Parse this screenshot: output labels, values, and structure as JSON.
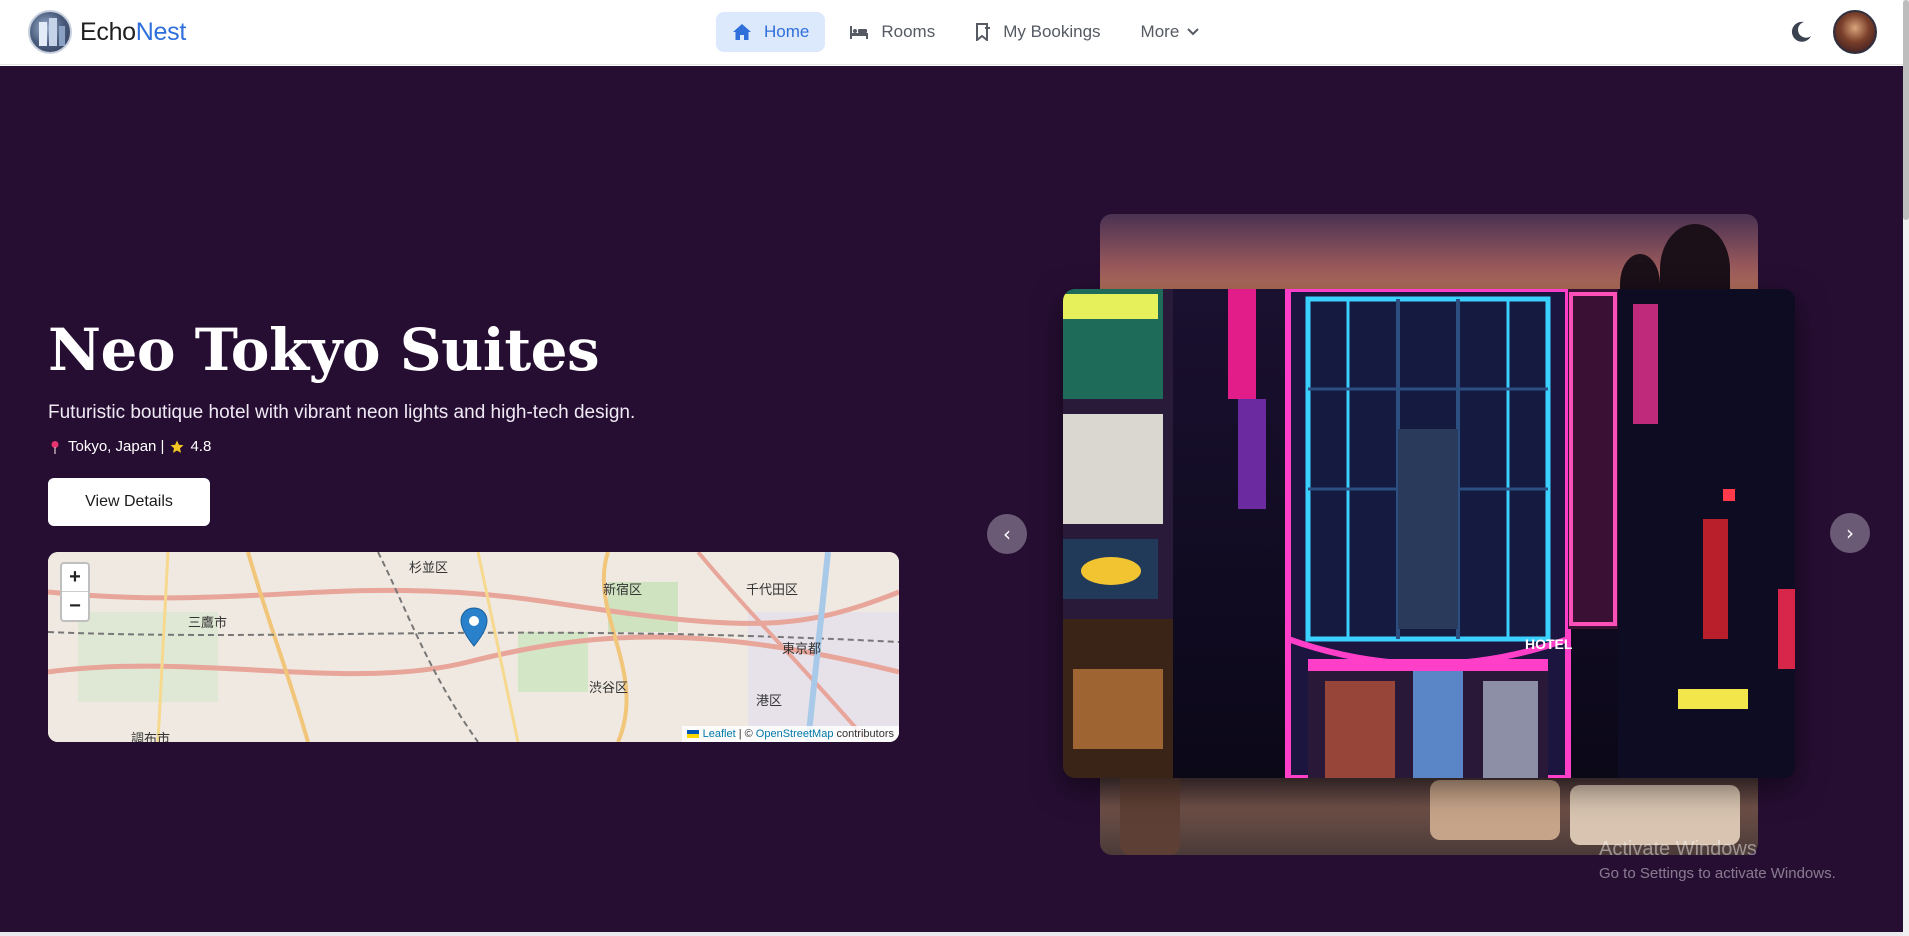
{
  "brand": {
    "name_part1": "Echo",
    "name_part2": "Nest",
    "logo_icon": "hotel-building-logo",
    "accent_color": "#2f6fdb"
  },
  "nav": {
    "items": [
      {
        "label": "Home",
        "icon": "home-icon",
        "active": true
      },
      {
        "label": "Rooms",
        "icon": "bed-icon",
        "active": false
      },
      {
        "label": "My Bookings",
        "icon": "bookmark-icon",
        "active": false
      },
      {
        "label": "More",
        "icon": "chevron-down-icon",
        "active": false
      }
    ],
    "theme_icon": "moon-icon",
    "avatar_icon": "user-avatar"
  },
  "hero": {
    "title": "Neo Tokyo Suites",
    "subtitle": "Futuristic boutique hotel with vibrant neon lights and high-tech design.",
    "location": "Tokyo, Japan |",
    "rating": "4.8",
    "button_label": "View Details",
    "background_color": "#260e33"
  },
  "map": {
    "labels": [
      "杉並区",
      "新宿区",
      "千代田区",
      "三鷹市",
      "東京都",
      "渋谷区",
      "港区",
      "調布市"
    ],
    "zoom_in": "+",
    "zoom_out": "−",
    "attribution": {
      "leaflet": "Leaflet",
      "separator": "| ©",
      "osm": "OpenStreetMap",
      "suffix": "contributors"
    }
  },
  "carousel": {
    "prev": "‹",
    "next": "›",
    "image_main": "neon hotel facade",
    "hotel_sign": "HOTEL"
  },
  "watermark": {
    "line1": "Activate Windows",
    "line2": "Go to Settings to activate Windows."
  }
}
